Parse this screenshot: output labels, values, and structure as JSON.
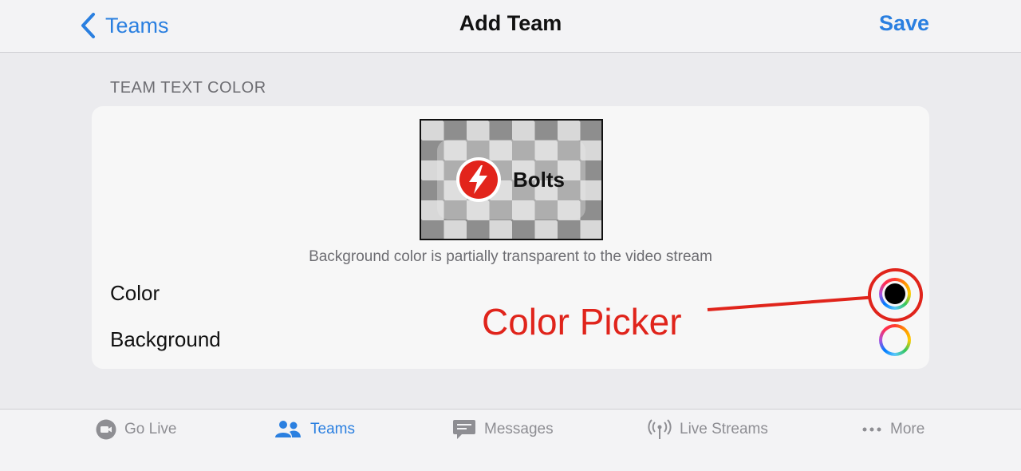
{
  "navbar": {
    "back_label": "Teams",
    "title": "Add Team",
    "save_label": "Save"
  },
  "section": {
    "header": "TEAM TEXT COLOR",
    "preview_team_name": "Bolts",
    "caption": "Background color is partially transparent to the video stream",
    "rows": [
      {
        "label": "Color",
        "swatch_color": "#000000"
      },
      {
        "label": "Background",
        "swatch_color": "#ffffff"
      }
    ]
  },
  "annotation": {
    "text": "Color Picker",
    "color": "#e0241b"
  },
  "tabbar": {
    "tabs": [
      {
        "label": "Go Live",
        "icon": "video-camera-icon",
        "active": false
      },
      {
        "label": "Teams",
        "icon": "people-icon",
        "active": true
      },
      {
        "label": "Messages",
        "icon": "message-icon",
        "active": false
      },
      {
        "label": "Live Streams",
        "icon": "antenna-icon",
        "active": false
      },
      {
        "label": "More",
        "icon": "ellipsis-icon",
        "active": false
      }
    ]
  },
  "colors": {
    "accent": "#2a7fe0",
    "logo_red": "#e2241b",
    "inactive_tab": "#8e8e93"
  }
}
